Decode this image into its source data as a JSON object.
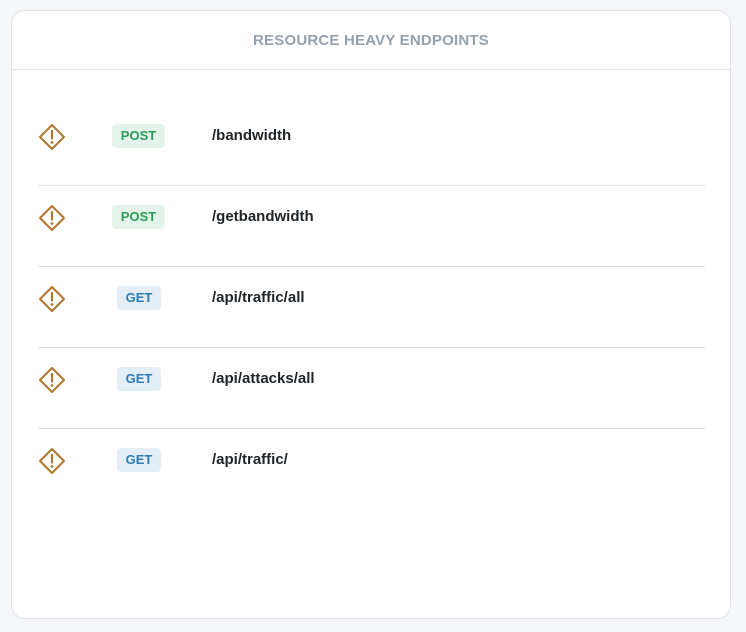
{
  "panel": {
    "title": "RESOURCE HEAVY ENDPOINTS"
  },
  "colors": {
    "warning_icon": "#b0772c",
    "post_badge_bg": "#e4f4ea",
    "post_badge_text": "#2a9d57",
    "get_badge_bg": "#e3eef7",
    "get_badge_text": "#2d7cb6"
  },
  "endpoints": [
    {
      "icon": "warning-diamond-icon",
      "method": "POST",
      "path": "/bandwidth"
    },
    {
      "icon": "warning-diamond-icon",
      "method": "POST",
      "path": "/getbandwidth"
    },
    {
      "icon": "warning-diamond-icon",
      "method": "GET",
      "path": "/api/traffic/all"
    },
    {
      "icon": "warning-diamond-icon",
      "method": "GET",
      "path": "/api/attacks/all"
    },
    {
      "icon": "warning-diamond-icon",
      "method": "GET",
      "path": "/api/traffic/"
    }
  ]
}
